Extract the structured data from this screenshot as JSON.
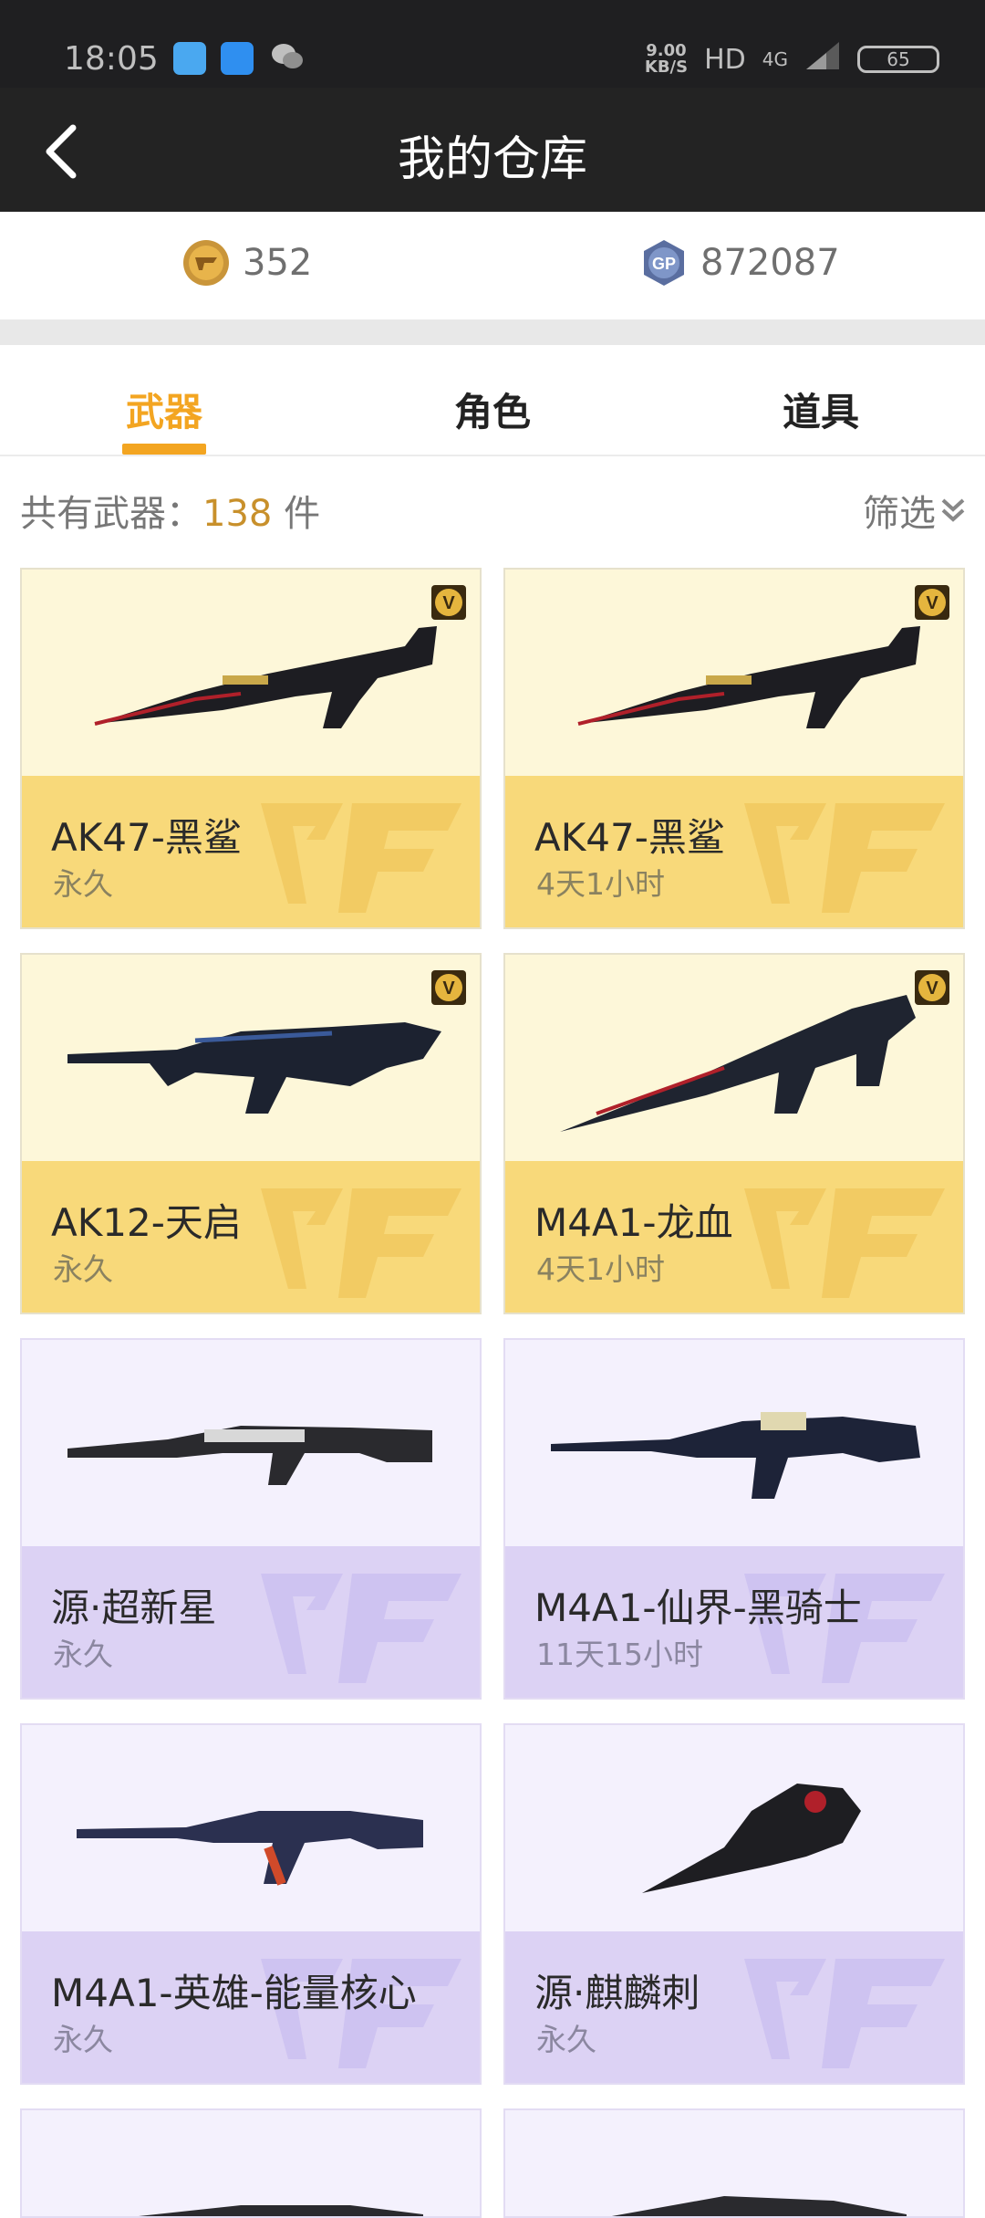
{
  "status_bar": {
    "time": "18:05",
    "speed_value": "9.00",
    "speed_unit": "KB/S",
    "network": "HD",
    "signal": "4G",
    "battery": "65"
  },
  "header": {
    "title": "我的仓库"
  },
  "currency": {
    "coin_value": "352",
    "gp_value": "872087"
  },
  "tabs": [
    {
      "label": "武器",
      "active": true
    },
    {
      "label": "角色",
      "active": false
    },
    {
      "label": "道具",
      "active": false
    }
  ],
  "summary": {
    "prefix": "共有武器：",
    "count": "138",
    "suffix": " 件",
    "filter_label": "筛选"
  },
  "items": [
    {
      "name": "AK47-黑鲨",
      "duration": "永久",
      "tier": "gold",
      "vip": true
    },
    {
      "name": "AK47-黑鲨",
      "duration": "4天1小时",
      "tier": "gold",
      "vip": true
    },
    {
      "name": "AK12-天启",
      "duration": "永久",
      "tier": "gold",
      "vip": true
    },
    {
      "name": "M4A1-龙血",
      "duration": "4天1小时",
      "tier": "gold",
      "vip": true
    },
    {
      "name": "源·超新星",
      "duration": "永久",
      "tier": "purple",
      "vip": false
    },
    {
      "name": "M4A1-仙界-黑骑士",
      "duration": "11天15小时",
      "tier": "purple",
      "vip": false
    },
    {
      "name": "M4A1-英雄-能量核心",
      "duration": "永久",
      "tier": "purple",
      "vip": false
    },
    {
      "name": "源·麒麟刺",
      "duration": "永久",
      "tier": "purple",
      "vip": false
    }
  ],
  "colors": {
    "accent": "#f3a521",
    "header_bg": "#232323",
    "gold_card": "#f8d97a",
    "purple_card": "#dcd2f4"
  }
}
